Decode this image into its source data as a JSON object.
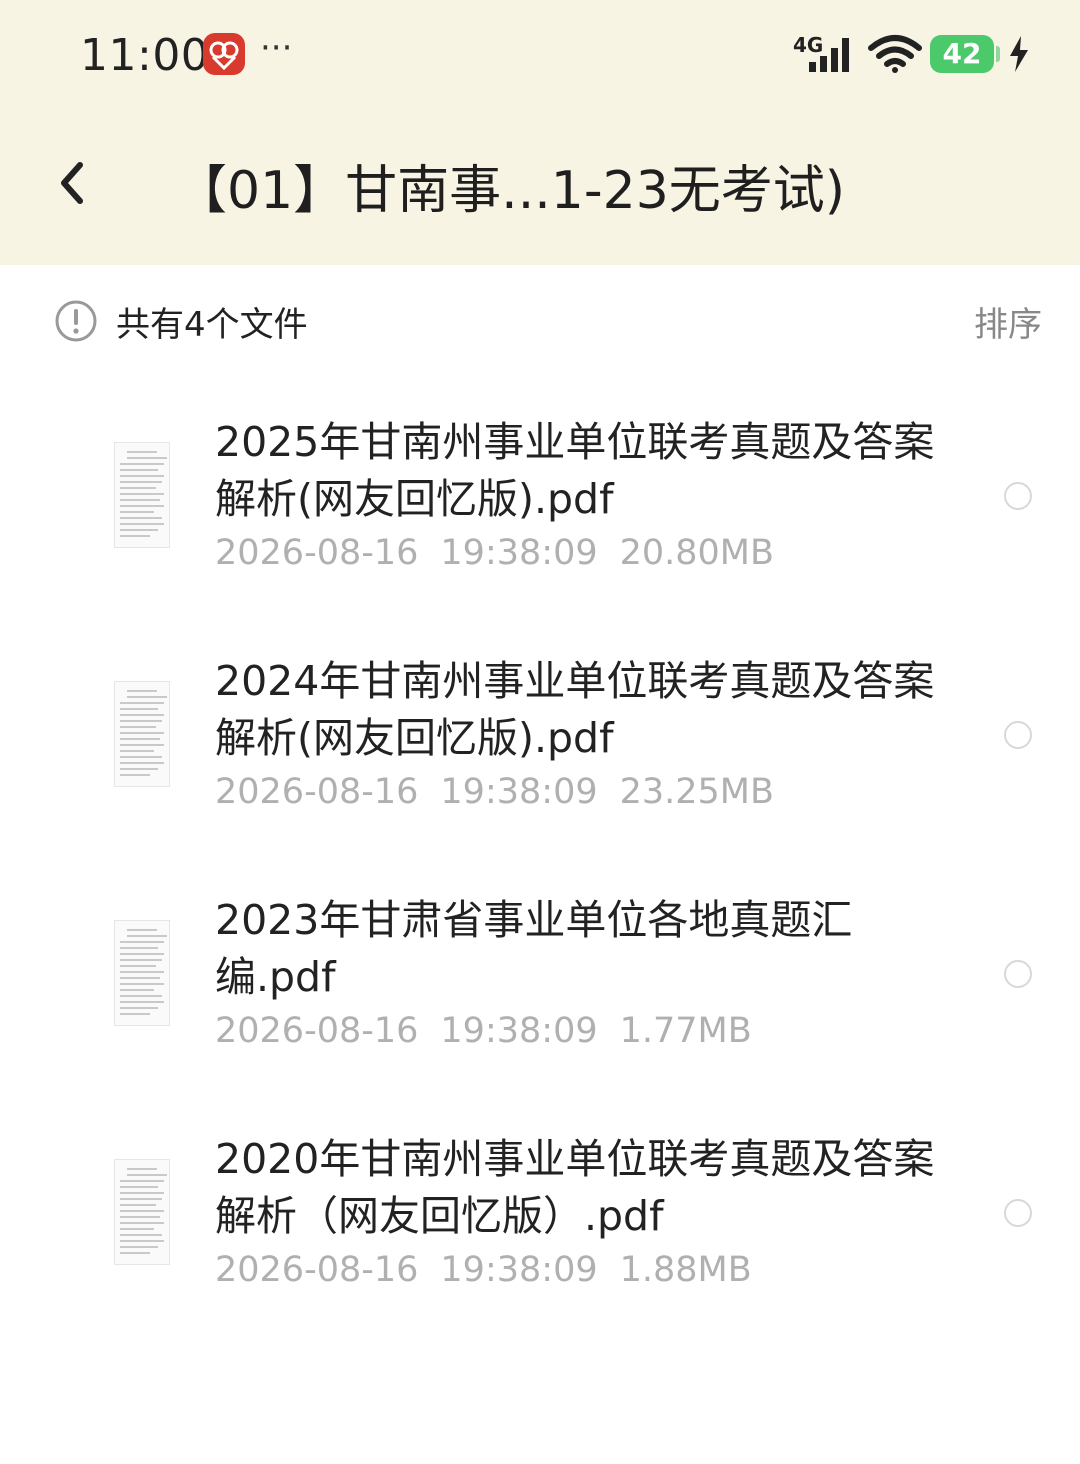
{
  "status_bar": {
    "time": "11:00",
    "network": "4G",
    "battery": "42",
    "more": "···",
    "colors": {
      "battery": "#4cc96a",
      "app_badge": "#d83a2e"
    }
  },
  "header": {
    "title": "【01】甘南事...1-23无考试)",
    "back_icon": "chevron-left-icon"
  },
  "info": {
    "file_count_text": "共有4个文件",
    "sort_label": "排序"
  },
  "files": [
    {
      "name": "2025年甘南州事业单位联考真题及答案解析(网友回忆版).pdf",
      "date": "2026-08-16",
      "time": "19:38:09",
      "size": "20.80MB"
    },
    {
      "name": "2024年甘南州事业单位联考真题及答案解析(网友回忆版).pdf",
      "date": "2026-08-16",
      "time": "19:38:09",
      "size": "23.25MB"
    },
    {
      "name": "2023年甘肃省事业单位各地真题汇编.pdf",
      "date": "2026-08-16",
      "time": "19:38:09",
      "size": "1.77MB"
    },
    {
      "name": "2020年甘南州事业单位联考真题及答案解析（网友回忆版）.pdf",
      "date": "2026-08-16",
      "time": "19:38:09",
      "size": "1.88MB"
    }
  ]
}
